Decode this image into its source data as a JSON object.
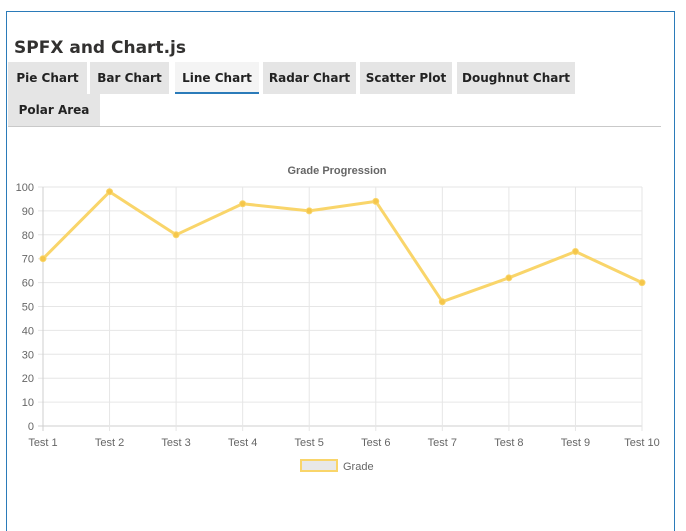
{
  "page": {
    "title": "SPFX and Chart.js"
  },
  "tabs": [
    {
      "label": "Pie Chart",
      "active": false
    },
    {
      "label": "Bar Chart",
      "active": false
    },
    {
      "label": "Line Chart",
      "active": true
    },
    {
      "label": "Radar Chart",
      "active": false
    },
    {
      "label": "Scatter Plot",
      "active": false
    },
    {
      "label": "Doughnut Chart",
      "active": false
    },
    {
      "label": "Polar Area",
      "active": false
    }
  ],
  "colors": {
    "accent": "#2b7bb9",
    "line": "#f9d56a",
    "point": "#f5c64a",
    "grid": "#e6e6e6"
  },
  "chart_data": {
    "type": "line",
    "title": "Grade Progression",
    "categories": [
      "Test 1",
      "Test 2",
      "Test 3",
      "Test 4",
      "Test 5",
      "Test 6",
      "Test 7",
      "Test 8",
      "Test 9",
      "Test 10"
    ],
    "series": [
      {
        "name": "Grade",
        "values": [
          70,
          98,
          80,
          93,
          90,
          94,
          52,
          62,
          73,
          60
        ]
      }
    ],
    "ylim": [
      0,
      100
    ],
    "yticks": [
      0,
      10,
      20,
      30,
      40,
      50,
      60,
      70,
      80,
      90,
      100
    ],
    "grid": true,
    "legend": "bottom"
  }
}
